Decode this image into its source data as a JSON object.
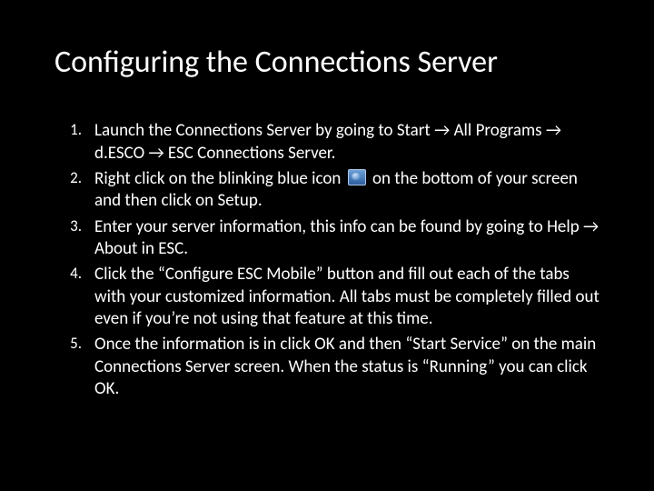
{
  "title": "Configuring the Connections Server",
  "items": [
    {
      "num": "1.",
      "text": "Launch the Connections Server by going to Start → All Programs → d.ESCO → ESC Connections Server."
    },
    {
      "num": "2.",
      "pre": "Right click on the blinking blue icon ",
      "post": " on the bottom of your screen and then click on Setup.",
      "has_icon": true
    },
    {
      "num": "3.",
      "text": "Enter your server information, this info can be found by going to Help → About in ESC."
    },
    {
      "num": "4.",
      "text": "Click the “Configure ESC Mobile” button and fill out each of the tabs with your customized information.  All tabs must be completely filled out even if you’re not using that feature  at this time."
    },
    {
      "num": "5.",
      "text": "Once the information is in click OK and then “Start Service” on the main Connections Server screen.  When the status is “Running” you can click OK."
    }
  ]
}
